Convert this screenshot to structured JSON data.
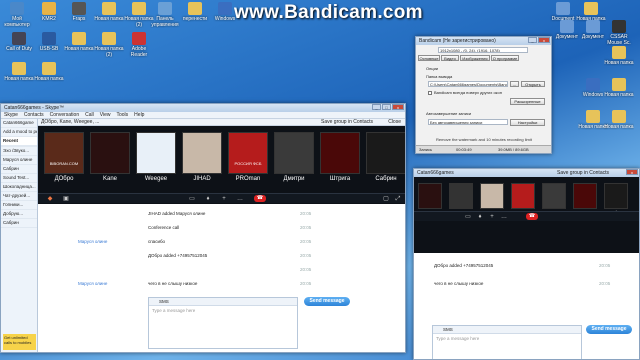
{
  "watermark": "www.Bandicam.com",
  "desktop_icons": [
    {
      "label": "Мой компьютер",
      "color": "#4a88c9"
    },
    {
      "label": "KMR2",
      "color": "#e7b347"
    },
    {
      "label": "Fraps",
      "color": "#555"
    },
    {
      "label": "Новая папка",
      "color": "#e7c35a"
    },
    {
      "label": "Новая папка (2)",
      "color": "#e7c35a"
    },
    {
      "label": "Панель управления",
      "color": "#6aa0d6"
    },
    {
      "label": "перенести",
      "color": "#e7c35a"
    },
    {
      "label": "Windows",
      "color": "#3a6ec0"
    },
    {
      "label": "Document",
      "color": "#6b9bd6"
    },
    {
      "label": "Новая папка",
      "color": "#e7c35a"
    },
    {
      "label": "Call of Duty",
      "color": "#445"
    },
    {
      "label": "USB-SB",
      "color": "#2a5aa0"
    },
    {
      "label": "Новая папка",
      "color": "#e7c35a"
    },
    {
      "label": "Новая папка (2)",
      "color": "#e7c35a"
    },
    {
      "label": "Adobe Reader",
      "color": "#c33"
    },
    {
      "label": "Новая папка",
      "color": "#e7c35a"
    },
    {
      "label": "Новая папка",
      "color": "#e7c35a"
    }
  ],
  "right_icons": [
    {
      "label": "Документ",
      "color": "#6b9bd6"
    },
    {
      "label": "Документ",
      "color": "#6b9bd6"
    },
    {
      "label": "CSSAR Mouse Sc.",
      "color": "#333"
    },
    {
      "label": "Новая папка",
      "color": "#e7c35a"
    },
    {
      "label": "Windows",
      "color": "#3a6ec0"
    },
    {
      "label": "Новая папка",
      "color": "#e7c35a"
    },
    {
      "label": "Новая папка",
      "color": "#e7c35a"
    },
    {
      "label": "Новая папка",
      "color": "#e7c35a"
    }
  ],
  "skype_main": {
    "title": "Catan666games - Skype™",
    "menu": [
      "Skype",
      "Contacts",
      "Conversation",
      "Call",
      "View",
      "Tools",
      "Help"
    ],
    "conv_title": "ДОбро, Kane, Weegee, ...",
    "header_right": "Save group in Contacts",
    "close_label": "Close",
    "left_rows": [
      "Catan666game",
      "Add a mood to people...",
      "Recent",
      "",
      "Эхо /Звуко...",
      "Маруся олине",
      "Сабрин",
      "Sound Test...",
      "Шоколадница...",
      "Чат-друзей...",
      "Гопники...",
      "Добрую...",
      "Сабрин"
    ],
    "left_bottom": [
      "phones",
      "Get unlimited calls to mobiles"
    ],
    "participants": [
      {
        "name": "ДОбро",
        "bg": "#5a2a1a",
        "tag": "BIBORAN.COM"
      },
      {
        "name": "Kane",
        "bg": "#2a1010",
        "tag": ""
      },
      {
        "name": "Weegee",
        "bg": "#e8f0f8",
        "tag": ""
      },
      {
        "name": "JIHAD",
        "bg": "#c8b8a8",
        "tag": ""
      },
      {
        "name": "PROman",
        "bg": "#b51c1c",
        "tag": "РОССИЯ ФСБ"
      },
      {
        "name": "Дмитри",
        "bg": "#3a3a3a",
        "tag": ""
      },
      {
        "name": "Штрига",
        "bg": "#4a0808",
        "tag": ""
      },
      {
        "name": "Сабрин",
        "bg": "#1a1a1a",
        "tag": ""
      }
    ],
    "messages": [
      {
        "sender": "",
        "text": "JIHAD added Маруся олине",
        "time": "20:05"
      },
      {
        "sender": "",
        "text": "Conference call",
        "time": "20:05"
      },
      {
        "sender": "Маруся олине",
        "text": "спасибо",
        "time": "20:05"
      },
      {
        "sender": "",
        "text": "ДОбро added +74957512045",
        "time": "20:05"
      },
      {
        "sender": "",
        "text": "",
        "time": "20:05"
      },
      {
        "sender": "Маруся олине",
        "text": "чего в не слышу низкое",
        "time": "20:05"
      }
    ],
    "compose_label": "SMS",
    "compose_placeholder": "Type a message here",
    "send_label": "Send message"
  },
  "bandicam": {
    "title": "Bandicam (Не зарегистрировано)",
    "size_label": "1912x1080 - (0, 24), (1916, 1078)",
    "tabs": [
      "Основные",
      "Видео",
      "Изображения",
      "О программе"
    ],
    "section_output": "Опции",
    "folder_label": "Папка вывода",
    "folder_path": "C:\\Users\\Catan666games\\Documents\\Bandicam",
    "btn_browse": "...",
    "btn_open": "Открыть",
    "chk_label": "Bandicam всегда поверх других окон",
    "btn_advanced": "Расширенные",
    "autorec_label": "Автозавершение записи",
    "autorec_value": "Без автозавершения записи",
    "btn_settings": "Настройки",
    "banner": "Remove the watermark and 10 minutes recording limit",
    "status_rec": "Запись",
    "status_time": "00:03:49",
    "status_size": "39.0MB / 89.6GB"
  },
  "skype_second": {
    "title": "Catan666games",
    "header_right": "Save group in Contacts",
    "participants": [
      {
        "name": "Kane",
        "bg": "#2a1010"
      },
      {
        "name": "Cat a",
        "bg": "#333"
      },
      {
        "name": "JIH AD",
        "bg": "#c8b8a8"
      },
      {
        "name": "PR Om",
        "bg": "#b51c1c"
      },
      {
        "name": "Дм",
        "bg": "#3a3a3a"
      },
      {
        "name": "Штр иг",
        "bg": "#4a0808"
      },
      {
        "name": "Саб ри",
        "bg": "#1a1a1a"
      }
    ],
    "messages": [
      {
        "sender": "",
        "text": "ДОбро added +74957512045",
        "time": "20:05"
      },
      {
        "sender": "",
        "text": "чего в не слышу низкое",
        "time": "20:05"
      }
    ],
    "compose_label": "SMS",
    "compose_placeholder": "Type a message here",
    "send_label": "Send message"
  }
}
